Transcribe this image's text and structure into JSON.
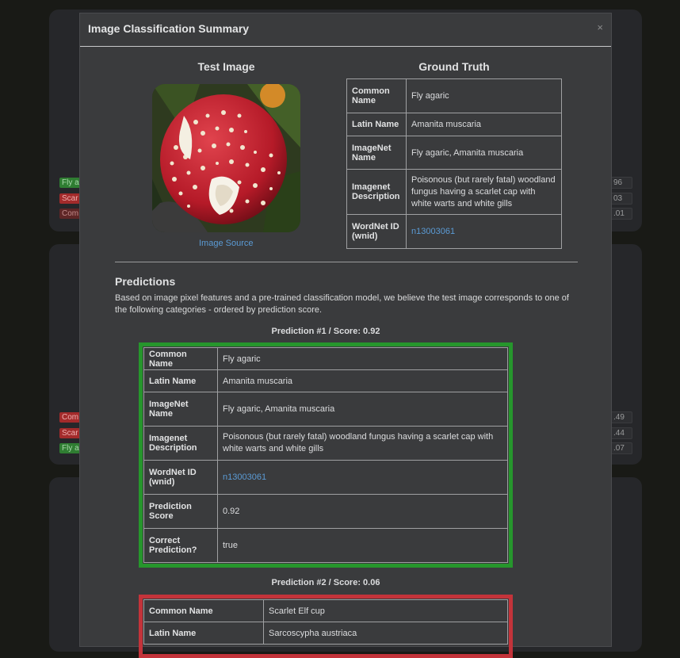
{
  "background": {
    "card1_badges": [
      {
        "text": "Fly a",
        "style": "green"
      },
      {
        "text": "Scar",
        "style": "red"
      },
      {
        "text": "Com",
        "style": "gray"
      }
    ],
    "card1_scores": [
      "96",
      "03",
      ".01"
    ],
    "card2_badges": [
      {
        "text": "Com",
        "style": "red"
      },
      {
        "text": "Scar",
        "style": "red"
      },
      {
        "text": "Fly a",
        "style": "green"
      }
    ],
    "card2_scores": [
      ".49",
      ".44",
      ".07"
    ]
  },
  "modal": {
    "title": "Image Classification Summary",
    "close": "×",
    "test_image_heading": "Test Image",
    "image_source_label": "Image Source",
    "ground_truth_heading": "Ground Truth",
    "ground_truth": [
      {
        "key": "Common Name",
        "value": "Fly agaric"
      },
      {
        "key": "Latin Name",
        "value": "Amanita muscaria"
      },
      {
        "key": "ImageNet Name",
        "value": "Fly agaric, Amanita muscaria"
      },
      {
        "key": "Imagenet Description",
        "value": "Poisonous (but rarely fatal) woodland fungus having a scarlet cap with white warts and white gills"
      },
      {
        "key": "WordNet ID (wnid)",
        "value": "n13003061",
        "link": true
      }
    ],
    "predictions_heading": "Predictions",
    "predictions_description": "Based on image pixel features and a pre-trained classification model, we believe the test image corresponds to one of the following categories - ordered by prediction score.",
    "predictions": [
      {
        "caption": "Prediction #1 / Score: 0.92",
        "correct": true,
        "border_color": "#26962c",
        "rows": [
          {
            "key": "Common Name",
            "value": "Fly agaric"
          },
          {
            "key": "Latin Name",
            "value": "Amanita muscaria"
          },
          {
            "key": "ImageNet Name",
            "value": "Fly agaric, Amanita muscaria"
          },
          {
            "key": "Imagenet Description",
            "value": "Poisonous (but rarely fatal) woodland fungus having a scarlet cap with white warts and white gills"
          },
          {
            "key": "WordNet ID (wnid)",
            "value": "n13003061",
            "link": true
          },
          {
            "key": "Prediction Score",
            "value": "0.92"
          },
          {
            "key": "Correct Prediction?",
            "value": "true"
          }
        ]
      },
      {
        "caption": "Prediction #2 / Score: 0.06",
        "correct": false,
        "border_color": "#c3333a",
        "rows": [
          {
            "key": "Common Name",
            "value": "Scarlet Elf cup"
          },
          {
            "key": "Latin Name",
            "value": "Sarcoscypha austriaca"
          }
        ]
      }
    ]
  }
}
